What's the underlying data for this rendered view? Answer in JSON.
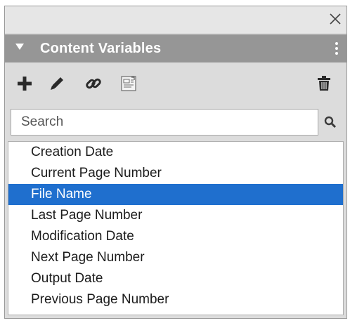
{
  "panel": {
    "title": "Content Variables",
    "icons": {
      "close": "close-icon",
      "collapse": "collapse-triangle-icon",
      "menu": "vertical-ellipsis-icon"
    }
  },
  "toolbar": {
    "buttons": [
      {
        "name": "add-variable-button",
        "icon": "plus-icon"
      },
      {
        "name": "edit-variable-button",
        "icon": "pencil-icon"
      },
      {
        "name": "link-variable-button",
        "icon": "link-icon"
      },
      {
        "name": "insert-variable-button",
        "icon": "insert-field-icon"
      },
      {
        "name": "delete-variable-button",
        "icon": "trash-icon"
      }
    ]
  },
  "search": {
    "placeholder": "Search",
    "value": "",
    "icon": "search-icon"
  },
  "list": {
    "selected_index": 2,
    "selected_color": "#1f6fce",
    "items": [
      {
        "label": "Creation Date"
      },
      {
        "label": "Current Page Number"
      },
      {
        "label": "File Name"
      },
      {
        "label": "Last Page Number"
      },
      {
        "label": "Modification Date"
      },
      {
        "label": "Next Page Number"
      },
      {
        "label": "Output Date"
      },
      {
        "label": "Previous Page Number"
      }
    ]
  }
}
